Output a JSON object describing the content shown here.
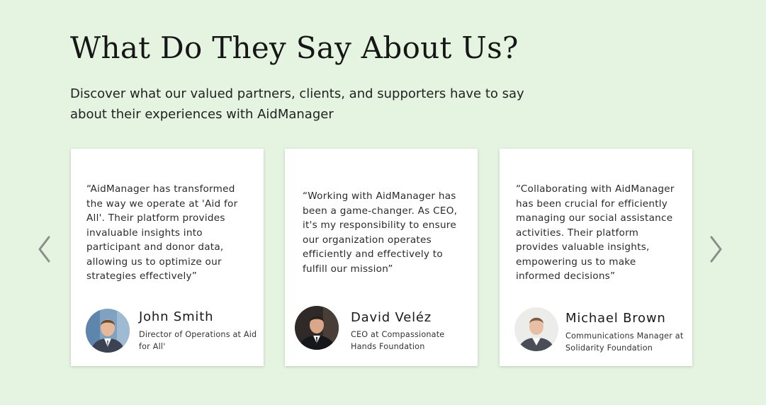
{
  "header": {
    "title": "What Do They Say About Us?",
    "subtitle": "Discover what our valued partners, clients, and supporters have to say about their experiences with AidManager"
  },
  "carousel": {
    "prev_icon": "chevron-left-icon",
    "next_icon": "chevron-right-icon",
    "arrow_color": "#8a8f89"
  },
  "testimonials": [
    {
      "quote": "“AidManager has transformed the way we operate at 'Aid for All'. Their platform provides invaluable insights into participant and donor data, allowing us to optimize our strategies effectively”",
      "name": "John Smith",
      "role": "Director of Operations at Aid for All'"
    },
    {
      "quote": "“Working with AidManager has been a game-changer. As CEO, it's my responsibility to ensure our organization operates efficiently and effectively to fulfill our mission”",
      "name": "David Veléz",
      "role": "CEO at Compassionate Hands Foundation"
    },
    {
      "quote": "“Collaborating with AidManager has been crucial for efficiently managing our social assistance activities. Their platform provides valuable insights, empowering us to make informed decisions”",
      "name": "Michael Brown",
      "role": "Communications Manager at Solidarity Foundation"
    }
  ],
  "colors": {
    "page_background": "#e5f4e0",
    "card_background": "#ffffff",
    "text": "#1c1c1c"
  }
}
